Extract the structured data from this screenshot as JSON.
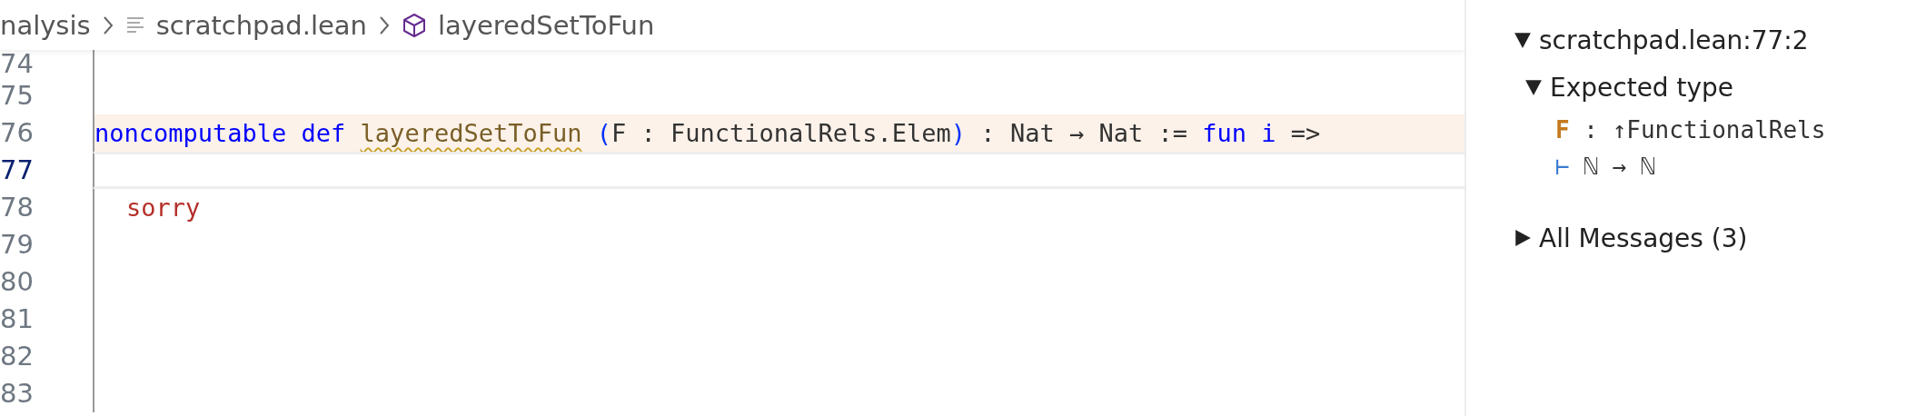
{
  "breadcrumb": [
    {
      "kind": "folder",
      "label": "nalysis"
    },
    {
      "kind": "file",
      "label": "scratchpad.lean"
    },
    {
      "kind": "symbol",
      "label": "layeredSetToFun"
    }
  ],
  "editor": {
    "lines": [
      {
        "number": "74",
        "highlighted": false,
        "current": false
      },
      {
        "number": "75",
        "highlighted": false,
        "current": false
      },
      {
        "number": "76",
        "highlighted": true,
        "current": false,
        "tokens": [
          {
            "kind": "keyword",
            "text": "noncomputable def "
          },
          {
            "kind": "function",
            "text": "layeredSetToFun",
            "warning": true
          },
          {
            "kind": "bracket",
            "text": " ("
          },
          {
            "kind": "plain",
            "text": "F : FunctionalRels.Elem"
          },
          {
            "kind": "bracket",
            "text": ")"
          },
          {
            "kind": "plain",
            "text": " : Nat → Nat := "
          },
          {
            "kind": "keyword",
            "text": "fun i"
          },
          {
            "kind": "plain",
            "text": " =>"
          }
        ]
      },
      {
        "number": "77",
        "highlighted": false,
        "current": true
      },
      {
        "number": "78",
        "highlighted": false,
        "current": false,
        "indented": true,
        "tokens": [
          {
            "kind": "error",
            "text": "sorry"
          }
        ]
      },
      {
        "number": "79",
        "highlighted": false,
        "current": false
      },
      {
        "number": "80",
        "highlighted": false,
        "current": false
      },
      {
        "number": "81",
        "highlighted": false,
        "current": false
      },
      {
        "number": "82",
        "highlighted": false,
        "current": false
      },
      {
        "number": "83",
        "highlighted": false,
        "current": false
      }
    ]
  },
  "infoview": {
    "position": {
      "label": "scratchpad.lean:77:2",
      "expanded": true
    },
    "expected_type": {
      "label": "Expected type",
      "expanded": true,
      "hypotheses": [
        {
          "name": "F",
          "separator": ":",
          "type": "↑FunctionalRels"
        }
      ],
      "goal": {
        "turnstile": "⊢",
        "type": "ℕ → ℕ"
      }
    },
    "messages": {
      "label": "All Messages (3)",
      "expanded": false
    }
  }
}
